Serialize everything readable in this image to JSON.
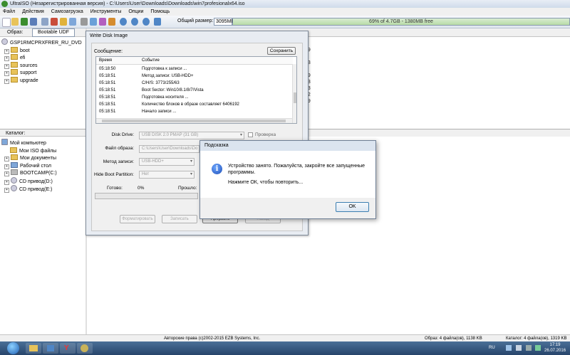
{
  "window": {
    "title": "UltraISO (Незарегистрированная версия) - C:\\Users\\User\\Downloads\\Downloads\\win7profesionalx64.iso"
  },
  "menu": [
    "Файл",
    "Действия",
    "Самозагрузка",
    "Инструменты",
    "Опции",
    "Помощь"
  ],
  "toolbar": {
    "size_label": "Общий размер:",
    "size_value": "3095MB",
    "size_bar_text": "69% of 4.7GB - 1380MB free"
  },
  "image_pane": {
    "label": "Образ:",
    "bootable": "Bootable UDF",
    "root": "GSP1RMCPRXFRER_RU_DVD",
    "folders": [
      "boot",
      "efi",
      "sources",
      "support",
      "upgrade"
    ]
  },
  "catalog_pane": {
    "label": "Каталог:",
    "root": "Мой компьютер",
    "items": [
      "Мои ISO файлы",
      "Мои документы",
      "Рабочий стол",
      "BOOTCAMP(C:)",
      "CD привод(D:)",
      "CD привод(E:)"
    ]
  },
  "right_partial_numbers": [
    "49",
    "1",
    "33",
    "2",
    "49",
    "33",
    "33",
    "72",
    "49"
  ],
  "write_dialog": {
    "title": "Write Disk Image",
    "message_label": "Сообщение:",
    "save_button": "Сохранить",
    "columns": {
      "time": "Время",
      "event": "Событие"
    },
    "log": [
      {
        "time": "05:18:50",
        "event": "Подготовка к записи ..."
      },
      {
        "time": "05:18:51",
        "event": "Метод записи: USB-HDD+"
      },
      {
        "time": "05:18:51",
        "event": "C/H/S: 3773/255/63"
      },
      {
        "time": "05:18:51",
        "event": "Boot Sector: Win10/8.1/8/7/Vista"
      },
      {
        "time": "05:18:51",
        "event": "Подготовка носителя ..."
      },
      {
        "time": "05:18:51",
        "event": "Количество блоков в образе составляет 6406192"
      },
      {
        "time": "05:18:51",
        "event": "Начало записи ..."
      }
    ],
    "disk_drive_label": "Disk Drive:",
    "disk_drive_value": "USB DISK 2.0    PMAP (31 GB)",
    "verify_label": "Проверка",
    "image_file_label": "Файл образа:",
    "image_file_value": "C:\\Users\\User\\Downloads\\Do",
    "write_method_label": "Метод записи:",
    "write_method_value": "USB-HDD+",
    "hide_boot_label": "Hide Boot Partition:",
    "hide_boot_value": "Нет",
    "done_label": "Готово:",
    "done_value": "0%",
    "elapsed_label": "Прошло:",
    "buttons": {
      "format": "Форматировать",
      "write": "Записать",
      "abort": "Прервать",
      "back": "Назад"
    }
  },
  "tip_dialog": {
    "title": "Подсказка",
    "message1": "Устройство занято. Пожалуйста, закройте все запущенные программы.",
    "message2": "Нажмите ОК, чтобы повторить...",
    "ok_button": "OK"
  },
  "status": {
    "copyright": "Авторские права (c)2002-2015 EZB Systems, Inc.",
    "image_info": "Образ: 4 файла(ов), 1138 KB",
    "catalog_info": "Каталог: 4 файла(ов), 1319 KB"
  },
  "taskbar": {
    "lang": "RU",
    "time": "17:19",
    "date": "26.07.2016"
  },
  "colors": {
    "accent": "#1f5fb3",
    "progress_green": "#b8dba7"
  }
}
